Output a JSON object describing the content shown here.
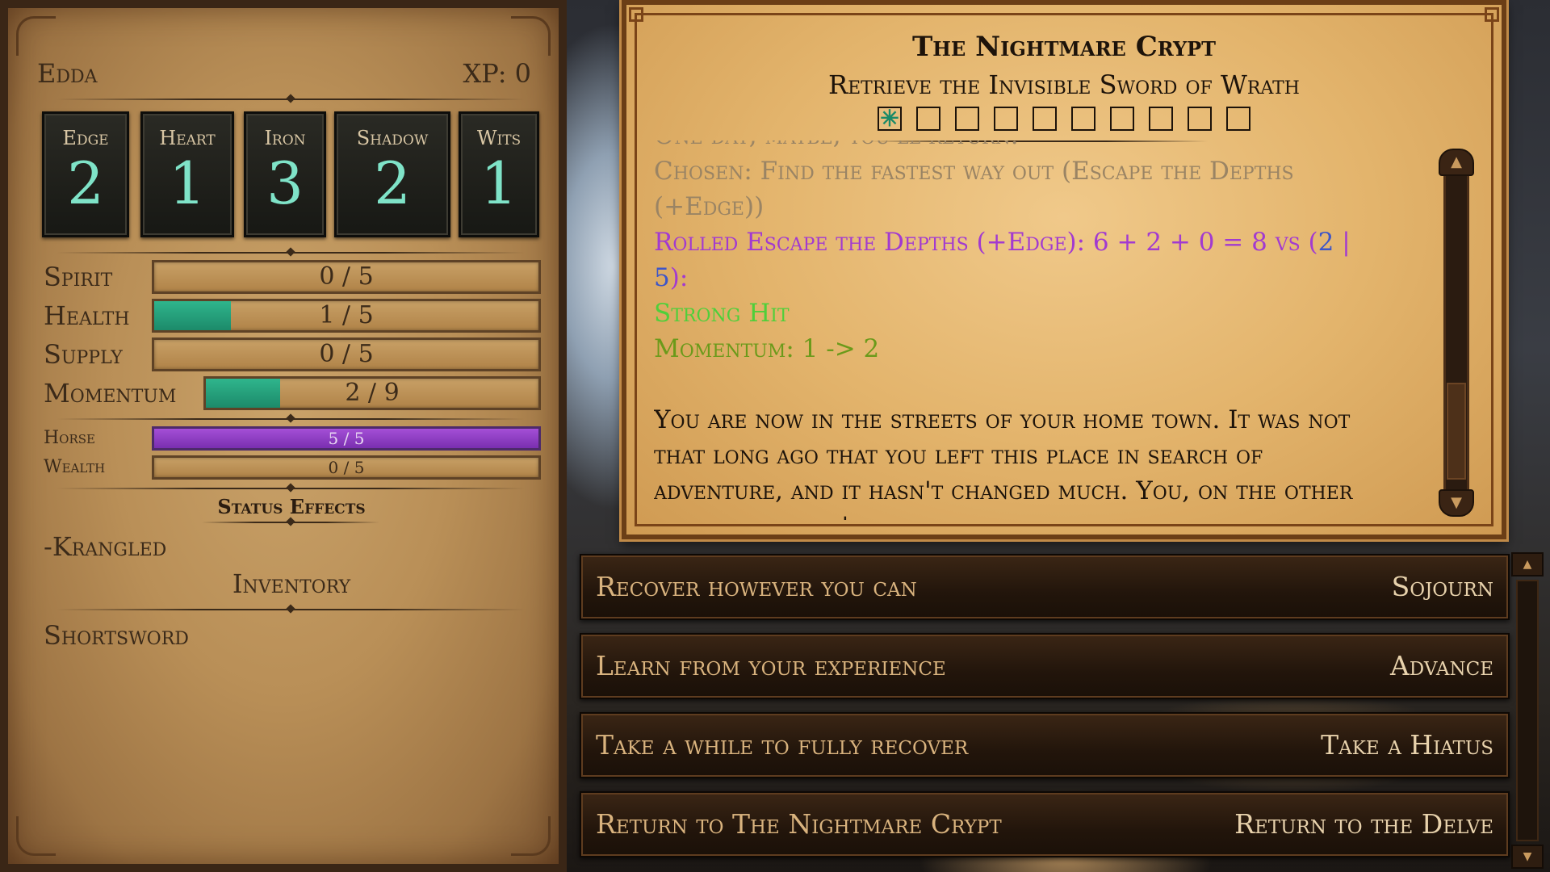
{
  "character": {
    "name": "Edda",
    "xp": "XP: 0"
  },
  "stats": [
    {
      "label": "Edge",
      "value": "2"
    },
    {
      "label": "Heart",
      "value": "1"
    },
    {
      "label": "Iron",
      "value": "3"
    },
    {
      "label": "Shadow",
      "value": "2"
    },
    {
      "label": "Wits",
      "value": "1"
    }
  ],
  "meters": {
    "spirit": {
      "label": "Spirit",
      "text": "0 / 5",
      "value": 0,
      "max": 5
    },
    "health": {
      "label": "Health",
      "text": "1 / 5",
      "value": 1,
      "max": 5
    },
    "supply": {
      "label": "Supply",
      "text": "0 / 5",
      "value": 0,
      "max": 5
    },
    "momentum": {
      "label": "Momentum",
      "text": "2 / 9",
      "value": 2,
      "max": 9
    },
    "horse": {
      "label": "Horse",
      "text": "5 / 5",
      "value": 5,
      "max": 5
    },
    "wealth": {
      "label": "Wealth",
      "text": "0 / 5",
      "value": 0,
      "max": 5
    }
  },
  "status": {
    "title": "Status Effects",
    "items": [
      "-Krangled"
    ]
  },
  "inventory": {
    "title": "Inventory",
    "items": [
      "Shortsword"
    ]
  },
  "story": {
    "title": "The Nightmare Crypt",
    "quest": "Retrieve the Invisible Sword of Wrath",
    "progress_total": 10,
    "progress_marked": 1,
    "progress_mark_glyph": "✳",
    "log": {
      "faded_line": "One day, maybe, you'll return.",
      "chosen": "Chosen: Find the fastest way out (Escape the Depths (+Edge))",
      "roll_prefix": "Rolled Escape the Depths (+Edge): 6 + 2 + 0 = 8 vs (",
      "roll_d1": "2",
      "roll_sep": " | ",
      "roll_d2": "5",
      "roll_suffix": "):",
      "result": "Strong Hit",
      "momentum": "Momentum: 1 -> 2",
      "narration": "You are now in the streets of your home town.  It was not that long ago that you left this place in search of adventure, and it hasn't changed much.  You, on the other hand, well that's a different story."
    },
    "scroll_up_glyph": "▲",
    "scroll_down_glyph": "▼"
  },
  "choices": [
    {
      "text": "Recover however you can",
      "move": "Sojourn"
    },
    {
      "text": "Learn from your experience",
      "move": "Advance"
    },
    {
      "text": "Take a while to fully recover",
      "move": "Take a Hiatus"
    },
    {
      "text": "Return to The Nightmare Crypt",
      "move": "Return to the Delve"
    }
  ],
  "colors": {
    "momentum_fill": "#2fb58c",
    "horse_fill": "#a44fd6",
    "roll_text": "#a23ad0",
    "strong_hit": "#4fcf3a",
    "momentum_text": "#6b9a1a",
    "stat_value": "#7fe3c8"
  }
}
